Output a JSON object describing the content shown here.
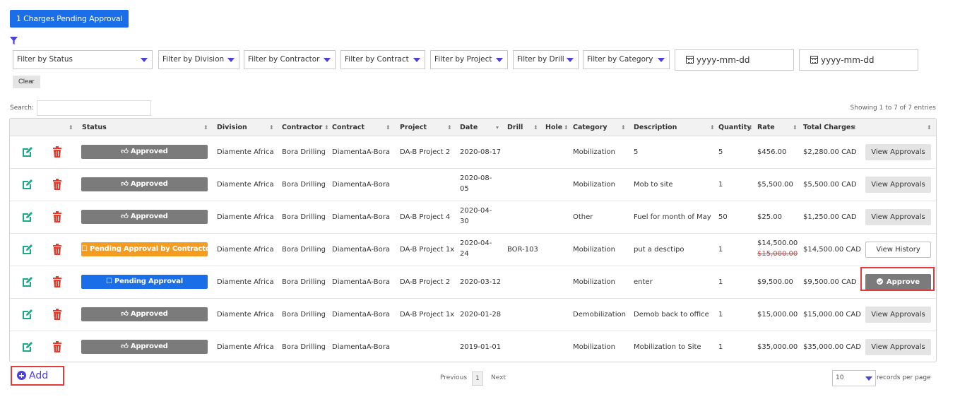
{
  "banner": {
    "label": "1 Charges Pending Approval"
  },
  "filters": {
    "status": "Filter by Status",
    "division": "Filter by Division",
    "contractor": "Filter by Contractor",
    "contract": "Filter by Contract",
    "project": "Filter by Project",
    "drill": "Filter by Drill",
    "category": "Filter by Category",
    "date_from_placeholder": "yyyy-mm-dd",
    "date_to_placeholder": "yyyy-mm-dd",
    "clear_label": "Clear"
  },
  "search": {
    "label": "Search:",
    "value": ""
  },
  "showing": "Showing 1 to 7 of 7 entries",
  "columns": [
    "Status",
    "Division",
    "Contractor",
    "Contract",
    "Project",
    "Date",
    "Drill",
    "Hole",
    "Category",
    "Description",
    "Quantity",
    "Rate",
    "Total Charges"
  ],
  "rows": [
    {
      "status": "Approved",
      "status_type": "approved",
      "division": "Diamente Africa",
      "contractor": "Bora Drilling",
      "contract": "DiamentaA-Bora",
      "project": "DA-B Project 2",
      "date_l1": "2020-08-17",
      "date_l2": "",
      "drill": "",
      "hole": "",
      "category": "Mobilization",
      "description": "5",
      "quantity": "5",
      "rate": "$456.00",
      "rate_old": "",
      "total": "$2,280.00 CAD",
      "action": "View Approvals",
      "action_type": "view"
    },
    {
      "status": "Approved",
      "status_type": "approved",
      "division": "Diamente Africa",
      "contractor": "Bora Drilling",
      "contract": "DiamentaA-Bora",
      "project": "",
      "date_l1": "2020-08-",
      "date_l2": "05",
      "drill": "",
      "hole": "",
      "category": "Mobilization",
      "description": "Mob to site",
      "quantity": "1",
      "rate": "$5,500.00",
      "rate_old": "",
      "total": "$5,500.00 CAD",
      "action": "View Approvals",
      "action_type": "view"
    },
    {
      "status": "Approved",
      "status_type": "approved",
      "division": "Diamente Africa",
      "contractor": "Bora Drilling",
      "contract": "DiamentaA-Bora",
      "project": "DA-B Project 4",
      "date_l1": "2020-04-",
      "date_l2": "30",
      "drill": "",
      "hole": "",
      "category": "Other",
      "description": "Fuel for month of May",
      "quantity": "50",
      "rate": "$25.00",
      "rate_old": "",
      "total": "$1,250.00 CAD",
      "action": "View Approvals",
      "action_type": "view"
    },
    {
      "status": "Pending Approval by Contractor",
      "status_type": "contractor",
      "division": "Diamente Africa",
      "contractor": "Bora Drilling",
      "contract": "DiamentaA-Bora",
      "project": "DA-B Project 1x",
      "date_l1": "2020-04-",
      "date_l2": "24",
      "drill": "BOR-103",
      "hole": "",
      "category": "Mobilization",
      "description": "put a desctipo",
      "quantity": "1",
      "rate": "$14,500.00",
      "rate_old": "$15,000.00",
      "total": "$14,500.00 CAD",
      "action": "View History",
      "action_type": "history"
    },
    {
      "status": "Pending Approval",
      "status_type": "pending",
      "division": "Diamente Africa",
      "contractor": "Bora Drilling",
      "contract": "DiamentaA-Bora",
      "project": "DA-B Project 2",
      "date_l1": "2020-03-12",
      "date_l2": "",
      "drill": "",
      "hole": "",
      "category": "Mobilization",
      "description": "enter",
      "quantity": "1",
      "rate": "$9,500.00",
      "rate_old": "",
      "total": "$9,500.00 CAD",
      "action": "Approve",
      "action_type": "approve"
    },
    {
      "status": "Approved",
      "status_type": "approved",
      "division": "Diamente Africa",
      "contractor": "Bora Drilling",
      "contract": "DiamentaA-Bora",
      "project": "DA-B Project 1x",
      "date_l1": "2020-01-28",
      "date_l2": "",
      "drill": "",
      "hole": "",
      "category": "Demobilization",
      "description": "Demob back to office",
      "quantity": "1",
      "rate": "$15,000.00",
      "rate_old": "",
      "total": "$15,000.00 CAD",
      "action": "View Approvals",
      "action_type": "view"
    },
    {
      "status": "Approved",
      "status_type": "approved",
      "division": "Diamente Africa",
      "contractor": "Bora Drilling",
      "contract": "DiamentaA-Bora",
      "project": "",
      "date_l1": "2019-01-01",
      "date_l2": "",
      "drill": "",
      "hole": "",
      "category": "Mobilization",
      "description": "Mobilization to Site",
      "quantity": "1",
      "rate": "$35,000.00",
      "rate_old": "",
      "total": "$35,000.00 CAD",
      "action": "View Approvals",
      "action_type": "view"
    }
  ],
  "footer": {
    "add_label": "Add",
    "previous": "Previous",
    "page": "1",
    "next": "Next",
    "page_size": "10",
    "records_per_page": "records per page"
  },
  "colors": {
    "primary": "#1a6ee8",
    "accent": "#4b3fe0",
    "approved": "#7b7b7b",
    "contractor": "#f39c1f",
    "edit": "#1aaa8c",
    "delete": "#e53a2c",
    "highlight": "#e23b3b"
  },
  "icons": {
    "filter": "filter-funnel-icon",
    "edit": "edit-pencil-icon",
    "delete": "trash-icon",
    "thumbs_up": "thumbs-up-icon",
    "square": "square-icon",
    "check": "check-circle-icon",
    "calendar": "calendar-icon",
    "add": "plus-circle-icon"
  }
}
